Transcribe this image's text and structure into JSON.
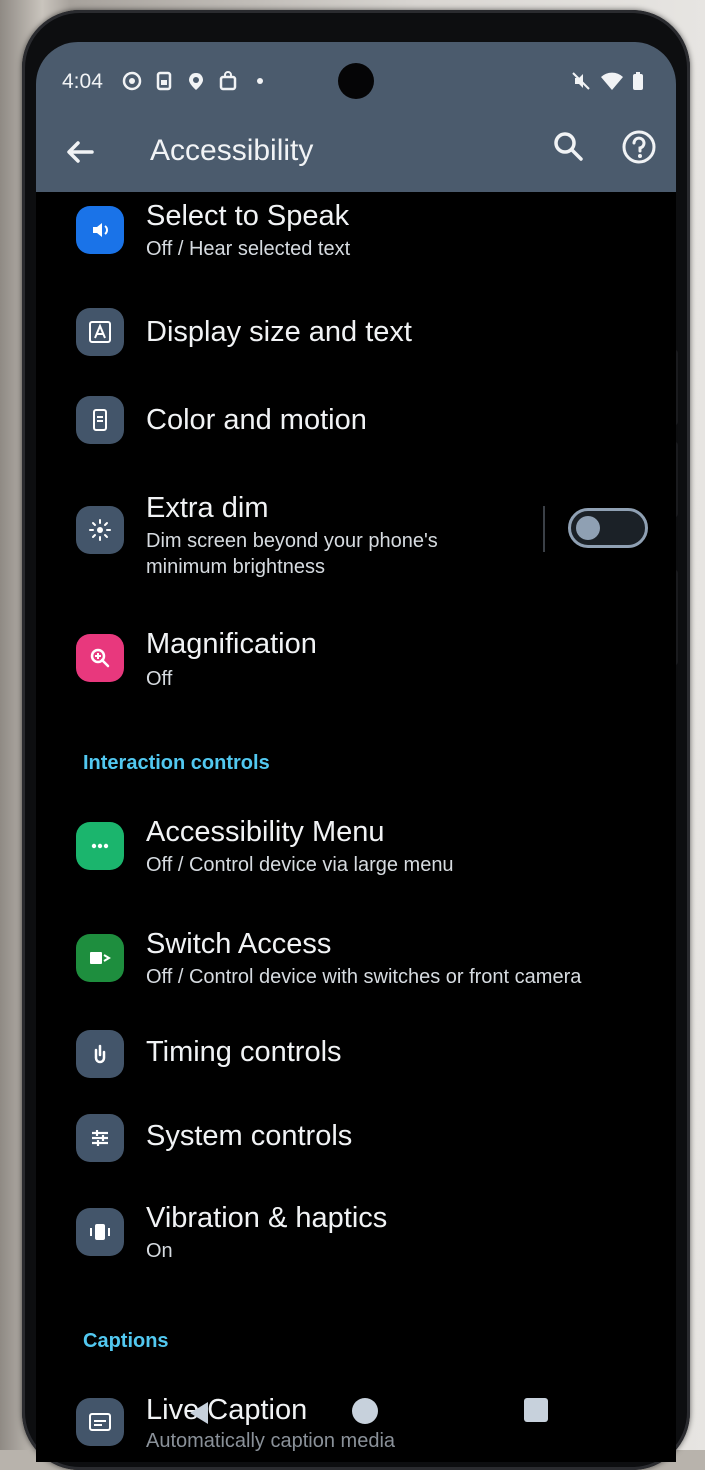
{
  "status_bar": {
    "time": "4:04"
  },
  "app_bar": {
    "title": "Accessibility"
  },
  "items_top": [
    {
      "title": "Select to Speak",
      "subtitle": "Off / Hear selected text",
      "icon": "speaker-icon",
      "icon_color": "#1a73e8"
    },
    {
      "title": "Display size and text",
      "icon": "text-size-icon",
      "icon_color": "#43556a"
    },
    {
      "title": "Color and motion",
      "icon": "color-motion-icon",
      "icon_color": "#43556a"
    },
    {
      "title": "Extra dim",
      "subtitle_line1": "Dim screen beyond your phone's",
      "subtitle_line2": "minimum brightness",
      "icon": "extra-dim-icon",
      "icon_color": "#43556a",
      "toggle_on": false
    },
    {
      "title": "Magnification",
      "subtitle": "Off",
      "icon": "magnify-icon",
      "icon_color": "#e8387d"
    }
  ],
  "section_interaction": "Interaction controls",
  "items_interaction": [
    {
      "title": "Accessibility Menu",
      "subtitle": "Off / Control device via large menu",
      "icon": "menu-dots-icon",
      "icon_color": "#1bb56d"
    },
    {
      "title": "Switch Access",
      "subtitle": "Off / Control device with switches or front camera",
      "icon": "switch-access-icon",
      "icon_color": "#1e8e3e"
    },
    {
      "title": "Timing controls",
      "icon": "timing-icon",
      "icon_color": "#43556a"
    },
    {
      "title": "System controls",
      "icon": "sliders-icon",
      "icon_color": "#43556a"
    },
    {
      "title": "Vibration & haptics",
      "subtitle": "On",
      "icon": "vibration-icon",
      "icon_color": "#43556a"
    }
  ],
  "section_captions": "Captions",
  "items_captions": [
    {
      "title": "Live Caption",
      "subtitle": "Automatically caption media",
      "icon": "caption-icon",
      "icon_color": "#43556a"
    }
  ]
}
